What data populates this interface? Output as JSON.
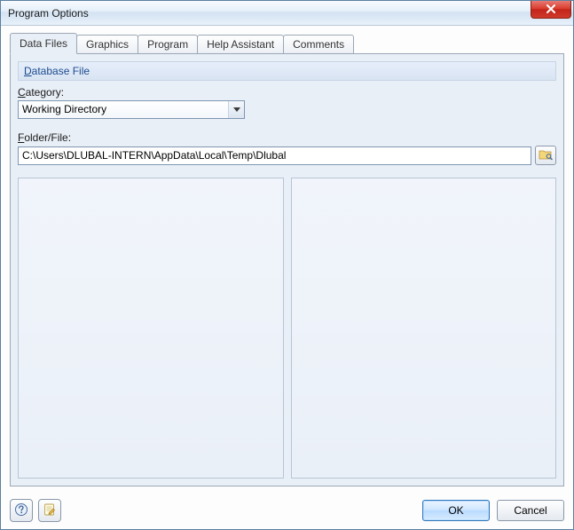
{
  "window": {
    "title": "Program Options"
  },
  "tabs": [
    {
      "label": "Data Files",
      "active": true
    },
    {
      "label": "Graphics",
      "active": false
    },
    {
      "label": "Program",
      "active": false
    },
    {
      "label": "Help Assistant",
      "active": false
    },
    {
      "label": "Comments",
      "active": false
    }
  ],
  "panel": {
    "header_prefix": "D",
    "header_rest": "atabase File",
    "category_label_prefix": "C",
    "category_label_rest": "ategory:",
    "category_value": "Working Directory",
    "folder_label_prefix": "F",
    "folder_label_rest": "older/File:",
    "folder_value": "C:\\Users\\DLUBAL-INTERN\\AppData\\Local\\Temp\\Dlubal"
  },
  "footer": {
    "ok": "OK",
    "cancel": "Cancel"
  },
  "icons": {
    "close": "close-icon",
    "browse": "folder-search-icon",
    "help": "help-icon",
    "edit": "edit-icon",
    "chevron_down": "chevron-down-icon"
  }
}
